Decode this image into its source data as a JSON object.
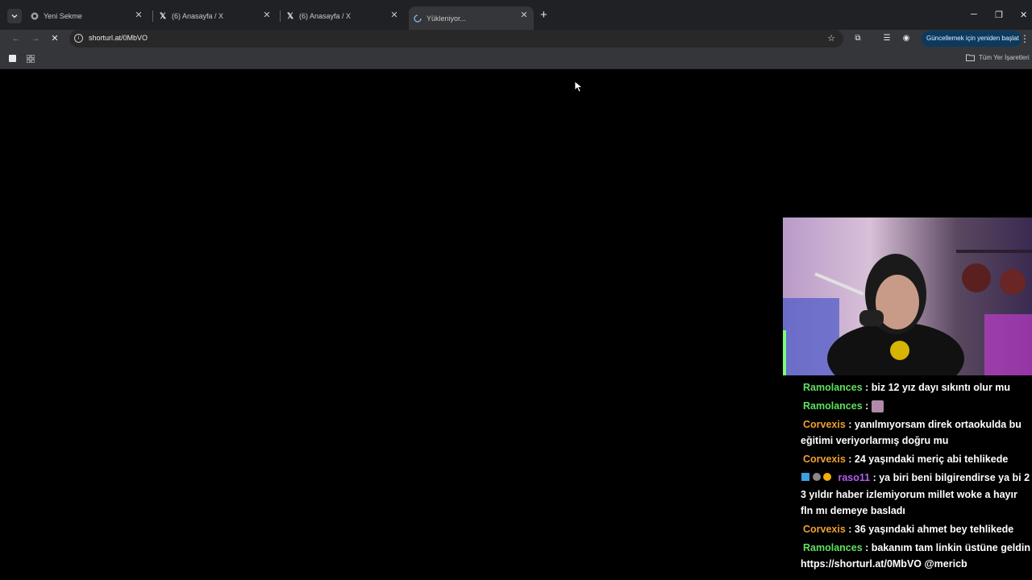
{
  "browser": {
    "tabs": [
      {
        "label": "Yeni Sekme",
        "icon": "chrome-icon"
      },
      {
        "label": "(6) Anasayfa / X",
        "icon": "x-logo-icon"
      },
      {
        "label": "(6) Anasayfa / X",
        "icon": "x-logo-icon"
      },
      {
        "label": "Yükleniyor...",
        "icon": "loading-spinner-icon",
        "active": true
      }
    ],
    "url": "shorturl.at/0MbVO",
    "update_button": "Güncellemek için yeniden başlat",
    "all_bookmarks": "Tüm Yer İşaretleri"
  },
  "chat": {
    "messages": [
      {
        "user": "Ramolances",
        "user_color": "#5fe05f",
        "text": "biz 12 yız dayı sıkıntı olur mu"
      },
      {
        "user": "Ramolances",
        "user_color": "#5fe05f",
        "text": "",
        "emote": "emote-image"
      },
      {
        "user": "Corvexis",
        "user_color": "#f0a030",
        "text": "yanılmıyorsam direk ortaokulda bu eğitimi veriyorlarmış doğru mu"
      },
      {
        "user": "Corvexis",
        "user_color": "#f0a030",
        "text": "24 yaşındaki meriç abi tehlikede"
      },
      {
        "user": "raso11",
        "user_color": "#b45cf0",
        "text": "ya biri beni bilgirendirse ya bi 2 3 yıldır haber izlemiyorum millet woke a hayır fln mı demeye basladı",
        "badges": true
      },
      {
        "user": "Corvexis",
        "user_color": "#f0a030",
        "text": "36 yaşındaki ahmet bey tehlikede"
      },
      {
        "user": "Ramolances",
        "user_color": "#5fe05f",
        "text": "bakanım tam linkin üstüne geldin https://shorturl.at/0MbVO @mericb"
      }
    ]
  }
}
